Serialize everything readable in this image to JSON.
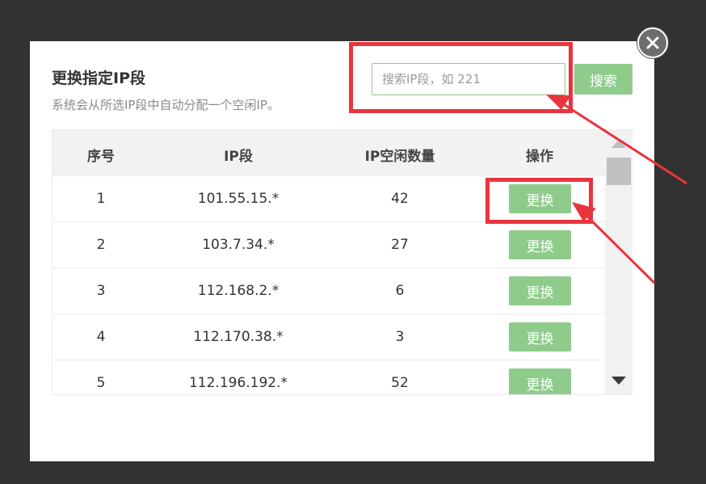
{
  "dialog": {
    "title": "更换指定IP段",
    "subtitle": "系统会从所选IP段中自动分配一个空闲IP。",
    "search_placeholder": "搜索IP段，如 221",
    "search_button": "搜索"
  },
  "table": {
    "headers": [
      "序号",
      "IP段",
      "IP空闲数量",
      "操作"
    ],
    "rows": [
      {
        "index": "1",
        "segment": "101.55.15.*",
        "free": "42",
        "action": "更换"
      },
      {
        "index": "2",
        "segment": "103.7.34.*",
        "free": "27",
        "action": "更换"
      },
      {
        "index": "3",
        "segment": "112.168.2.*",
        "free": "6",
        "action": "更换"
      },
      {
        "index": "4",
        "segment": "112.170.38.*",
        "free": "3",
        "action": "更换"
      },
      {
        "index": "5",
        "segment": "112.196.192.*",
        "free": "52",
        "action": "更换"
      }
    ]
  },
  "colors": {
    "accent_green": "#8fcc8c",
    "highlight_red": "#e8353d",
    "overlay": "#323232"
  },
  "icons": {
    "close": "close-icon",
    "scroll_up": "triangle-up-icon",
    "scroll_down": "triangle-down-icon"
  }
}
